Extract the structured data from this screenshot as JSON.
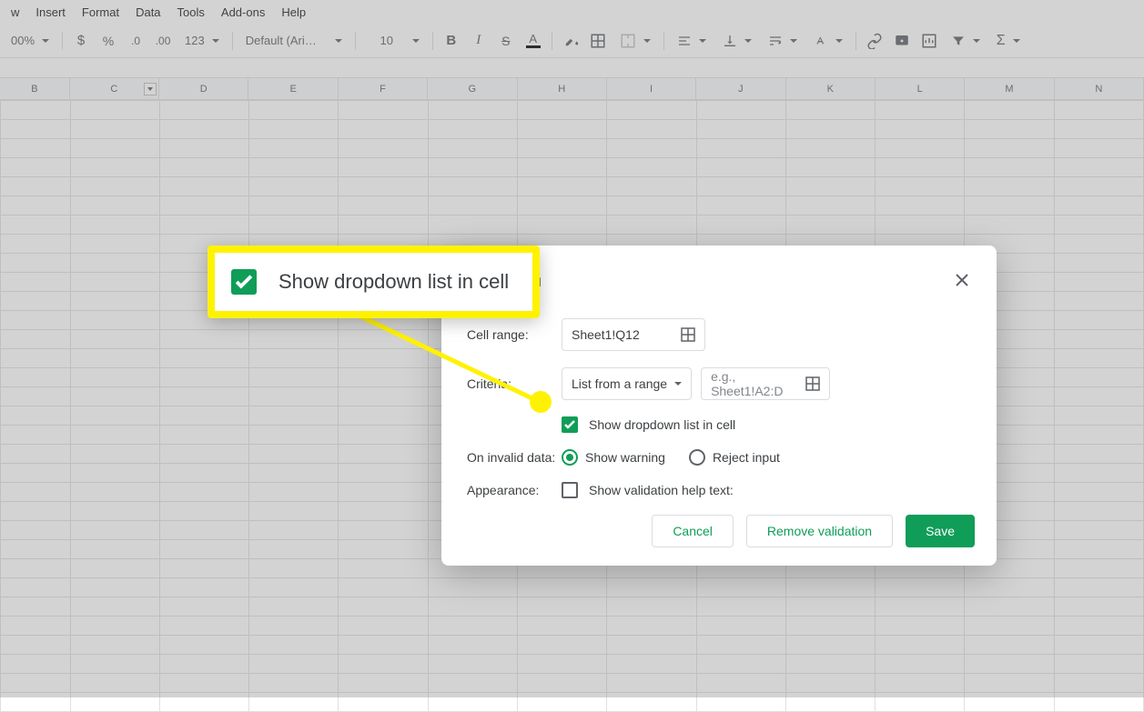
{
  "menubar": [
    "w",
    "Insert",
    "Format",
    "Data",
    "Tools",
    "Add-ons",
    "Help"
  ],
  "toolbar": {
    "zoom": "00%",
    "font": "Default (Ari…",
    "font_size": "10"
  },
  "columns": [
    "B",
    "C",
    "D",
    "E",
    "F",
    "G",
    "H",
    "I",
    "J",
    "K",
    "L",
    "M",
    "N"
  ],
  "filtered_column_index": 1,
  "dialog": {
    "title": "alidation",
    "labels": {
      "cell_range": "Cell range:",
      "criteria": "Criteria:",
      "on_invalid": "On invalid data:",
      "appearance": "Appearance:"
    },
    "cell_range_value": "Sheet1!Q12",
    "criteria_dropdown": "List from a range",
    "criteria_range_placeholder": "e.g., Sheet1!A2:D",
    "show_dropdown_label": "Show dropdown list in cell",
    "show_dropdown_checked": true,
    "radio_warning": "Show warning",
    "radio_reject": "Reject input",
    "help_text_label": "Show validation help text:",
    "help_text_checked": false,
    "buttons": {
      "cancel": "Cancel",
      "remove": "Remove validation",
      "save": "Save"
    }
  },
  "callout": {
    "text": "Show dropdown list in cell"
  }
}
